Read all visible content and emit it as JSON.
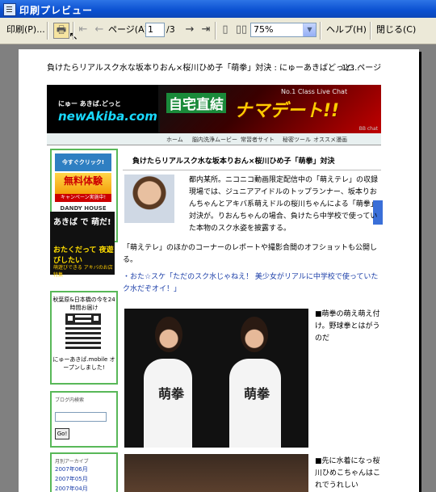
{
  "window": {
    "title": "印刷プレビュー"
  },
  "toolbar": {
    "print_label": "印刷(P)...",
    "page_label": "ページ(A)",
    "page_value": "1",
    "page_total": "/3",
    "zoom_value": "75%",
    "help_label": "ヘルプ(H)",
    "close_label": "閉じる(C)"
  },
  "page": {
    "running_header": "負けたらリアルスク水な坂本りおん×桜川ひめ子「萌拳」対決 : にゅーあきばどっと...",
    "page_count": "1/3 ページ"
  },
  "site": {
    "logo_sub": "にゅー あきば.どっと",
    "logo_main": "newAkiba.com",
    "ad_main": "自宅直結",
    "ad_brand": "ナマデート!!",
    "ad_tag": "No.1 Class Live Chat",
    "ad_small": "BB chat"
  },
  "nav": [
    "ホーム",
    "脳内洗浄ムービー",
    "常習者サイト",
    "秘密ツール",
    "オススメ漫画"
  ],
  "sidebar": {
    "click_text": "今すぐクリック!",
    "trial_text": "無料体験",
    "campaign_text": "キャンペーン実施中!",
    "dandy_text": "DANDY HOUSE",
    "black_ad_1": "あきば で 萌だ!",
    "black_ad_2": "おたくだって 夜遊びしたい",
    "black_ad_3": "萌遊びできる アキバのお店特集",
    "qr_heading": "秋葉原&日本橋の今を24時間お届け",
    "qr_footer": "にゅーあきば.mobile オープンしました!",
    "search_heading": "ブログ内検索",
    "go_label": "Go!",
    "archive_heading": "月別アーカイブ",
    "archives": [
      "2007年06月",
      "2007年05月",
      "2007年04月"
    ]
  },
  "article": {
    "title": "負けたらリアルスク水な坂本りおん×桜川ひめ子「萌拳」対決",
    "para1": "都内某所。ニコニコ動画限定配信中の「萌えテレ」の収録現場では、ジュニアアイドルのトップランナー、坂本りおんちゃんとアキバ系萌えドルの桜川ちゃんによる「萌拳」対決が。りおんちゃんの場合、負けたら中学校で使っていた本物のスク水姿を披露する。",
    "para2": "「萌えテレ」のほかのコーナーのレポートや撮影合間のオフショットも公開しる。",
    "link": "・おた☆スケ「ただのスク水じゃねえ！ 美少女がリアルに中学校で使っていたク水だぞオイ！」",
    "caption1": "■萌拳の萌え萌え付け。野球拳とはがうのだ",
    "caption2": "■先に水着になっ桜川ひめこちゃんはこれでうれしい",
    "shirt_text": "萌拳"
  },
  "colors": {
    "titlebar": "#0a4fd0",
    "sidebar_border": "#58b858",
    "link": "#1b3ea8"
  }
}
